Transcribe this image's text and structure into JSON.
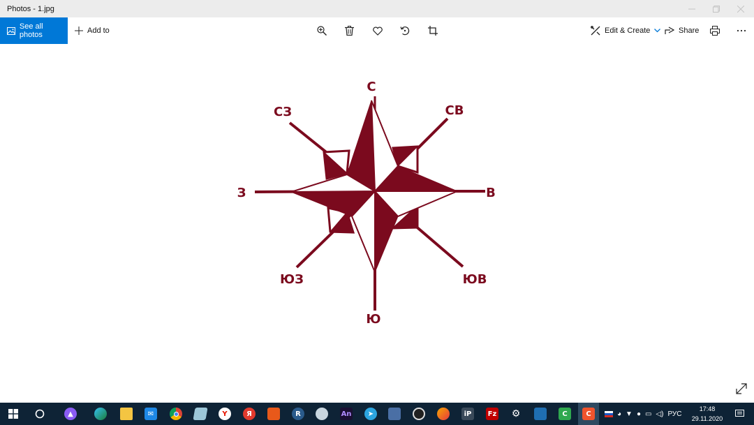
{
  "window": {
    "title": "Photos - 1.jpg"
  },
  "toolbar": {
    "see_all_photos": "See all photos",
    "add_to": "Add to",
    "edit_create": "Edit & Create",
    "share": "Share"
  },
  "image": {
    "labels": {
      "n": "С",
      "ne": "СВ",
      "e": "В",
      "se": "ЮВ",
      "s": "Ю",
      "sw": "ЮЗ",
      "w": "З",
      "nw": "СЗ"
    },
    "color": "#7b0a1e"
  },
  "taskbar": {
    "language": "РУС",
    "time": "17:48",
    "date": "29.11.2020",
    "apps": [
      "windows-start",
      "search",
      "alice",
      "edge",
      "file-explorer",
      "mail",
      "chrome",
      "notepad",
      "yandex-y",
      "yandex-browser",
      "office",
      "r-app",
      "paint",
      "animate",
      "telegram",
      "save-app",
      "obs",
      "paint-app",
      "ip-app",
      "filezilla",
      "settings",
      "photos",
      "camtasia-green",
      "camtasia-orange"
    ],
    "colors": {
      "taskbar_bg": "#0e2336",
      "accent": "#0078d7"
    }
  }
}
